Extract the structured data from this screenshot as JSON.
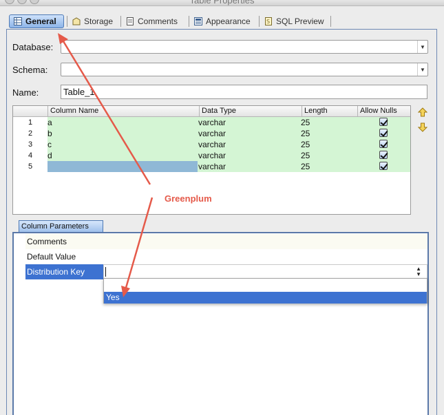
{
  "window": {
    "title": "Table Properties"
  },
  "tabs": [
    {
      "label": "General",
      "icon": "table-icon",
      "active": true
    },
    {
      "label": "Storage",
      "icon": "storage-icon",
      "active": false
    },
    {
      "label": "Comments",
      "icon": "comments-icon",
      "active": false
    },
    {
      "label": "Appearance",
      "icon": "appearance-icon",
      "active": false
    },
    {
      "label": "SQL Preview",
      "icon": "sql-preview-icon",
      "active": false
    }
  ],
  "form": {
    "database_label": "Database:",
    "database_value": "",
    "schema_label": "Schema:",
    "schema_value": "",
    "name_label": "Name:",
    "name_value": "Table_1"
  },
  "columns_table": {
    "headers": [
      "Column Name",
      "Data Type",
      "Length",
      "Allow Nulls"
    ],
    "rows": [
      {
        "num": "1",
        "name": "a",
        "type": "varchar",
        "length": "25",
        "allow_nulls": true
      },
      {
        "num": "2",
        "name": "b",
        "type": "varchar",
        "length": "25",
        "allow_nulls": true
      },
      {
        "num": "3",
        "name": "c",
        "type": "varchar",
        "length": "25",
        "allow_nulls": true
      },
      {
        "num": "4",
        "name": "d",
        "type": "varchar",
        "length": "25",
        "allow_nulls": true
      },
      {
        "num": "5",
        "name": "",
        "type": "varchar",
        "length": "25",
        "allow_nulls": true
      }
    ]
  },
  "column_parameters": {
    "tab_label": "Column Parameters",
    "rows": [
      {
        "name": "Comments",
        "value": ""
      },
      {
        "name": "Default Value",
        "value": ""
      },
      {
        "name": "Distribution Key",
        "value": ""
      }
    ],
    "dropdown_options": [
      "",
      "Yes"
    ],
    "selected_option": "Yes"
  },
  "annotation": {
    "text": "Greenplum",
    "color": "#e55a4a"
  },
  "colors": {
    "row_green": "#d4f5d4",
    "selected_blue": "#3d72d1",
    "name_cell_selected": "#8fb8d6",
    "accent_border": "#5a78a8"
  }
}
